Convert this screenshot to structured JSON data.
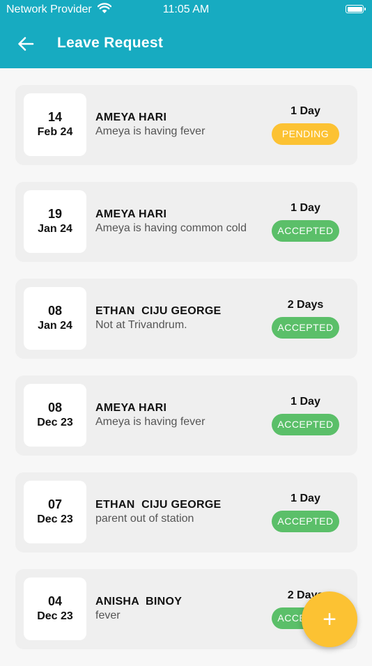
{
  "status_bar": {
    "provider": "Network Provider",
    "time": "11:05 AM"
  },
  "header": {
    "title": "Leave Request",
    "back_icon": "arrow-left-icon"
  },
  "colors": {
    "header": "#17abc1",
    "pending": "#fcc233",
    "accepted": "#5bbf69",
    "fab": "#fcc233"
  },
  "leaves": [
    {
      "day": "14",
      "month": "Feb 24",
      "name": "AMEYA HARI",
      "reason": "Ameya is having fever",
      "duration": "1 Day",
      "status": "PENDING"
    },
    {
      "day": "19",
      "month": "Jan 24",
      "name": "AMEYA HARI",
      "reason": "Ameya is having common cold",
      "duration": "1 Day",
      "status": "ACCEPTED"
    },
    {
      "day": "08",
      "month": "Jan 24",
      "name": "ETHAN  CIJU GEORGE",
      "reason": "Not at Trivandrum.",
      "duration": "2 Days",
      "status": "ACCEPTED"
    },
    {
      "day": "08",
      "month": "Dec 23",
      "name": "AMEYA HARI",
      "reason": "Ameya is having fever",
      "duration": "1 Day",
      "status": "ACCEPTED"
    },
    {
      "day": "07",
      "month": "Dec 23",
      "name": "ETHAN  CIJU GEORGE",
      "reason": "parent out of station",
      "duration": "1 Day",
      "status": "ACCEPTED"
    },
    {
      "day": "04",
      "month": "Dec 23",
      "name": "ANISHA  BINOY",
      "reason": "fever",
      "duration": "2 Days",
      "status": "ACCEPTED"
    }
  ],
  "fab": {
    "label": "+",
    "icon": "plus-icon"
  }
}
